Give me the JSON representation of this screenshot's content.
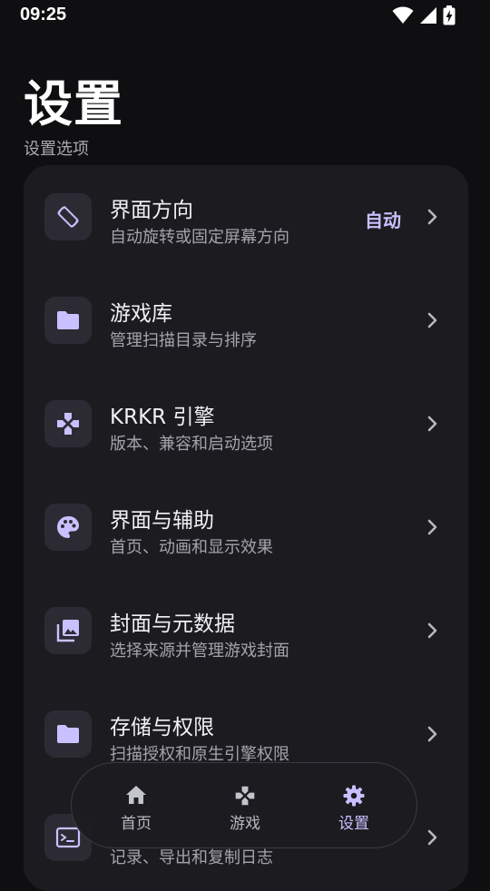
{
  "status_bar": {
    "time": "09:25"
  },
  "header": {
    "title": "设置",
    "section_label": "设置选项"
  },
  "settings": [
    {
      "title": "界面方向",
      "subtitle": "自动旋转或固定屏幕方向",
      "value": "自动",
      "icon": "screen-rotation-icon"
    },
    {
      "title": "游戏库",
      "subtitle": "管理扫描目录与排序",
      "icon": "folder-icon"
    },
    {
      "title": "KRKR 引擎",
      "subtitle": "版本、兼容和启动选项",
      "icon": "gamepad-icon"
    },
    {
      "title": "界面与辅助",
      "subtitle": "首页、动画和显示效果",
      "icon": "palette-icon"
    },
    {
      "title": "封面与元数据",
      "subtitle": "选择来源并管理游戏封面",
      "icon": "library-image-icon"
    },
    {
      "title": "存储与权限",
      "subtitle": "扫描授权和原生引擎权限",
      "icon": "folder-icon"
    },
    {
      "title": "",
      "subtitle": "记录、导出和复制日志",
      "icon": "terminal-icon"
    }
  ],
  "bottom_nav": {
    "items": [
      {
        "label": "首页",
        "icon": "home-icon",
        "active": false
      },
      {
        "label": "游戏",
        "icon": "gamepad-icon",
        "active": false
      },
      {
        "label": "设置",
        "icon": "gear-icon",
        "active": true
      }
    ],
    "accent_color": "#c9c1ff"
  },
  "colors": {
    "background": "#0f0f11",
    "card": "#1c1c20",
    "accent": "#c9c1ff",
    "icon_tile": "#2c2b34"
  }
}
